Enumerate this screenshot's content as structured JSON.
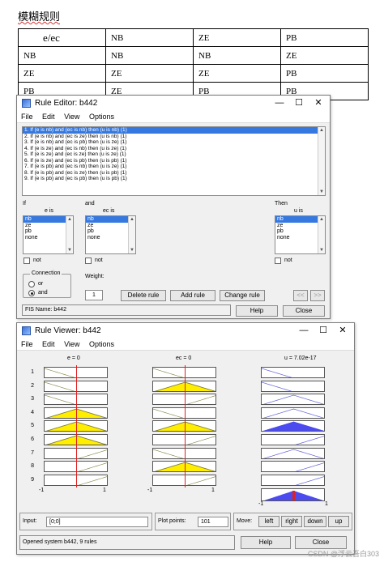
{
  "doc": {
    "heading": "模糊规则",
    "table": {
      "header": [
        "e/ec",
        "NB",
        "ZE",
        "PB"
      ],
      "rows": [
        [
          "NB",
          "NB",
          "NB",
          "ZE"
        ],
        [
          "ZE",
          "ZE",
          "ZE",
          "PB"
        ],
        [
          "PB",
          "ZE",
          "PB",
          "PB"
        ]
      ]
    }
  },
  "rule_editor": {
    "title": "Rule Editor: b442",
    "menu": [
      "File",
      "Edit",
      "View",
      "Options"
    ],
    "rules": [
      "1. If (e is nb) and (ec is nb) then (u is nb) (1)",
      "2. If (e is nb) and (ec is ze) then (u is nb) (1)",
      "3. If (e is nb) and (ec is pb) then (u is ze) (1)",
      "4. If (e is ze) and (ec is nb) then (u is ze) (1)",
      "5. If (e is ze) and (ec is ze) then (u is ze) (1)",
      "6. If (e is ze) and (ec is pb) then (u is pb) (1)",
      "7. If (e is pb) and (ec is nb) then (u is ze) (1)",
      "8. If (e is pb) and (ec is ze) then (u is pb) (1)",
      "9. If (e is pb) and (ec is pb) then (u is pb) (1)"
    ],
    "if_label": "If",
    "and_label": "and",
    "then_label": "Then",
    "e_is": "e is",
    "ec_is": "ec is",
    "u_is": "u is",
    "options": [
      "nb",
      "ze",
      "pb",
      "none"
    ],
    "not_label": "not",
    "connection_label": "Connection",
    "or_label": "or",
    "and_radio_label": "and",
    "weight_label": "Weight:",
    "weight_value": "1",
    "delete_rule": "Delete rule",
    "add_rule": "Add rule",
    "change_rule": "Change rule",
    "prev": "<<",
    "next": ">>",
    "status": "FIS Name: b442",
    "help": "Help",
    "close": "Close"
  },
  "rule_viewer": {
    "title": "Rule Viewer: b442",
    "menu": [
      "File",
      "Edit",
      "View",
      "Options"
    ],
    "e_label": "e = 0",
    "ec_label": "ec = 0",
    "u_label": "u = 7.02e-17",
    "row_numbers": [
      "1",
      "2",
      "3",
      "4",
      "5",
      "6",
      "7",
      "8",
      "9"
    ],
    "e_axis": [
      "-1",
      "1"
    ],
    "ec_axis": [
      "-1",
      "1"
    ],
    "u_axis": [
      "-1",
      "1"
    ],
    "input_label": "Input:",
    "input_value": "[0;0]",
    "plot_points_label": "Plot points:",
    "plot_points_value": "101",
    "move_label": "Move:",
    "move_buttons": [
      "left",
      "right",
      "down",
      "up"
    ],
    "status": "Opened system b442, 9 rules",
    "help": "Help",
    "close": "Close",
    "e_mf": [
      "nb",
      "nb",
      "nb",
      "ze",
      "ze",
      "ze",
      "pb",
      "pb",
      "pb"
    ],
    "ec_mf": [
      "nb",
      "ze",
      "pb",
      "nb",
      "ze",
      "pb",
      "nb",
      "ze",
      "pb"
    ],
    "u_mf": [
      "nb",
      "nb",
      "ze",
      "ze",
      "ze",
      "pb",
      "ze",
      "pb",
      "pb"
    ],
    "input_e": 0,
    "input_ec": 0,
    "output_u": 7.02e-17,
    "colors": {
      "input_fill": "#ffee00",
      "output_fill": "#4b4bf0",
      "line": "#e02020",
      "mf_line": "#7a7a3a"
    }
  },
  "watermark": "CSDN @浮云吾白303"
}
